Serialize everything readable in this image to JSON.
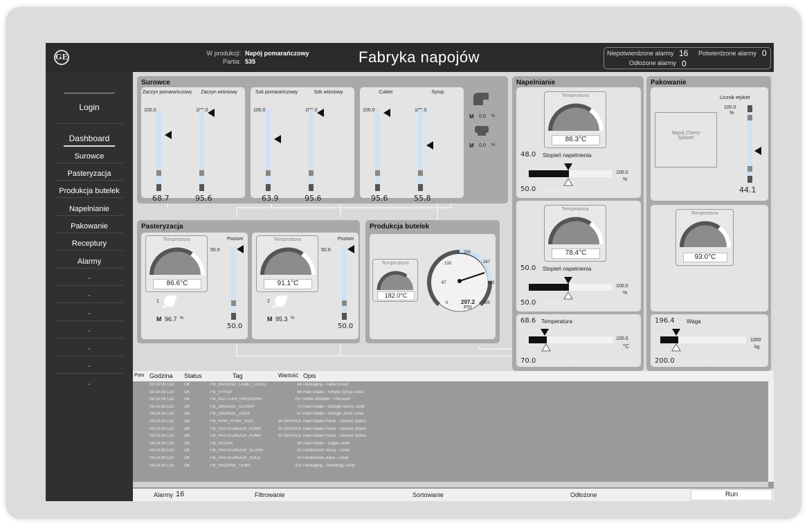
{
  "header": {
    "title": "Fabryka napojów",
    "production_label": "W produkcji:",
    "production_value": "Napój pomarańczowy",
    "batch_label": "Partia:",
    "batch_value": "535",
    "unack_label": "Niepotwierdzone alarmy",
    "unack_value": "16",
    "ack_label": "Potwierdzone alarmy",
    "ack_value": "0",
    "shelved_label": "Odłożone alarmy",
    "shelved_value": "0",
    "logo": "GE"
  },
  "sidebar": {
    "login": "Login",
    "items": [
      {
        "label": "Dashboard"
      },
      {
        "label": "Surowce"
      },
      {
        "label": "Pasteryzacja"
      },
      {
        "label": "Produkcja butelek"
      },
      {
        "label": "Napelnianie"
      },
      {
        "label": "Pakowanie"
      },
      {
        "label": "Receptury"
      },
      {
        "label": "Alarmy"
      }
    ],
    "placeholder": "-"
  },
  "surowce": {
    "title": "Surowce",
    "tanks": [
      {
        "label": "Zaczyn pomarańczowy",
        "max": "100.0",
        "value": "68.7",
        "level": 0.687
      },
      {
        "label": "Zaczyn wiśniowy",
        "max": "100.0",
        "value": "95.6",
        "level": 0.956
      },
      {
        "label": "Sok pomarańczowy",
        "max": "100.0",
        "value": "63.9",
        "level": 0.639
      },
      {
        "label": "Sok wiśniowy",
        "max": "100.0",
        "value": "95.6",
        "level": 0.956
      },
      {
        "label": "Cukier",
        "max": "100.0",
        "value": "95.6",
        "level": 0.956
      },
      {
        "label": "Syrop",
        "max": "100.0",
        "value": "55.8",
        "level": 0.558
      }
    ],
    "pumps": [
      {
        "mode": "M",
        "value": "0.0",
        "unit": "%"
      },
      {
        "mode": "M",
        "value": "0.0",
        "unit": "%"
      }
    ]
  },
  "pasteryzacja": {
    "title": "Pasteryzacja",
    "units": [
      {
        "gauge_label": "Temperatura",
        "temp": "86.6°C",
        "level_label": "Poziom",
        "level_max": "50.0",
        "level_value": "50.0",
        "pump_id": "1",
        "mode": "M",
        "pump_value": "96.7",
        "unit": "%"
      },
      {
        "gauge_label": "Temperatura",
        "temp": "91.1°C",
        "level_label": "Poziom",
        "level_max": "50.0",
        "level_value": "50.0",
        "pump_id": "2",
        "mode": "M",
        "pump_value": "95.3",
        "unit": "%"
      }
    ]
  },
  "produkcja": {
    "title": "Produkcja butelek",
    "gauge_label": "Temperatura",
    "temp": "182.0°C",
    "pressure": "297.2",
    "pressure_unit": "PSI",
    "dial_ticks": [
      "0",
      "67",
      "133",
      "200",
      "267",
      "333",
      "400"
    ]
  },
  "napelnianie": {
    "title": "Napelnianie",
    "stations": [
      {
        "gauge_label": "Temperatura",
        "temp": "86.3°C",
        "actual": "48.0",
        "fill_label": "Stopień napelnienia",
        "max": "100.0",
        "unit": "%",
        "setpoint": "50.0",
        "setpoint_label": "Wartość zadana"
      },
      {
        "gauge_label": "Temperatura",
        "temp": "78.4°C",
        "actual": "50.0",
        "fill_label": "Stopień napelnienia",
        "max": "100.0",
        "unit": "%",
        "setpoint": "50.0",
        "setpoint_label": "Wartość zadana"
      }
    ],
    "temp_slider": {
      "actual": "68.6",
      "label": "Temperatura",
      "max": "100.0",
      "unit": "°C",
      "setpoint": "70.0",
      "setpoint_label": "Wartość zadana"
    }
  },
  "pakowanie": {
    "title": "Pakowanie",
    "product": "Napój Cherry Splash!",
    "counter_label": "Licznik etykiet",
    "counter_max": "100.0",
    "counter_unit": "%",
    "counter_value": "44.1",
    "gauge_label": "Temperatura",
    "temp": "93.0°C",
    "weight_slider": {
      "actual": "196.4",
      "label": "Waga",
      "max": "1000",
      "unit": "kg",
      "setpoint": "200.0",
      "setpoint_label": "Wartość zadana"
    }
  },
  "alarm_table": {
    "columns": [
      "Poto",
      "Godzina",
      "Status",
      "Tag",
      "Wartość",
      "Opis"
    ],
    "rows": [
      [
        "",
        "09:14:09.133",
        "OK",
        "FB_PACKING_LABEL_LEVEL",
        "44",
        "Packaging - Label Count"
      ],
      [
        "",
        "09:14:09.133",
        "OK",
        "FB_SYRUP",
        "56",
        "Raw Intake - Simple Syrup Level"
      ],
      [
        "",
        "09:14:09.133",
        "OK",
        "FB_BOTTLER_PRESSURE",
        "297",
        "Bottle Moulder - Pressure"
      ],
      [
        "",
        "09:14:09.133",
        "OK",
        "FB_ORANGE_SLURRY",
        "70",
        "Raw Intake - Orange Slurry Level"
      ],
      [
        "",
        "09:14:09.133",
        "OK",
        "FB_ORANGE_JUICE",
        "67",
        "Raw Intake - Orange Juice Level"
      ],
      [
        "",
        "09:14:09.133",
        "OK",
        "FB_RAW_PUMP_OOS",
        "IN SERVICE",
        "Raw Intake Pump - Service Status"
      ],
      [
        "",
        "09:14:09.133",
        "OK",
        "FB_PASTEURIZER_PUMP",
        "IN SERVICE",
        "Raw Intake Pump - Service Status"
      ],
      [
        "",
        "09:14:09.133",
        "OK",
        "FB_PASTEURIZER_PUMP",
        "IN SERVICE",
        "Raw Intake Pump - Service Status"
      ],
      [
        "",
        "09:14:09.133",
        "OK",
        "FB_SUGAR",
        "96",
        "Raw Intake - Sugar Level"
      ],
      [
        "",
        "09:14:09.133",
        "OK",
        "FB_PASTEURIZER_SLURR",
        "50",
        "Pasteurizer Slurry - Level"
      ],
      [
        "",
        "09:14:09.133",
        "OK",
        "FB_PASTEURIZER_JUICE",
        "50",
        "Pasteurizer Juice - Level"
      ],
      [
        "",
        "09:14:09.133",
        "OK",
        "FB_PACKING_TEMP",
        "203",
        "Packaging - Shrinking Temp"
      ]
    ]
  },
  "footer": {
    "alarms_label": "Alarmy",
    "alarms_count": "16",
    "filter": "Filtrowanie",
    "sort": "Sortowanie",
    "shelved": "Odłożone",
    "run": "Run"
  },
  "colors": {
    "dark_band": "#5a5a5a",
    "gauge_fill": "#8c8c8c",
    "panel_gray": "#a9a9a9",
    "tube": "#cfe2f3"
  }
}
